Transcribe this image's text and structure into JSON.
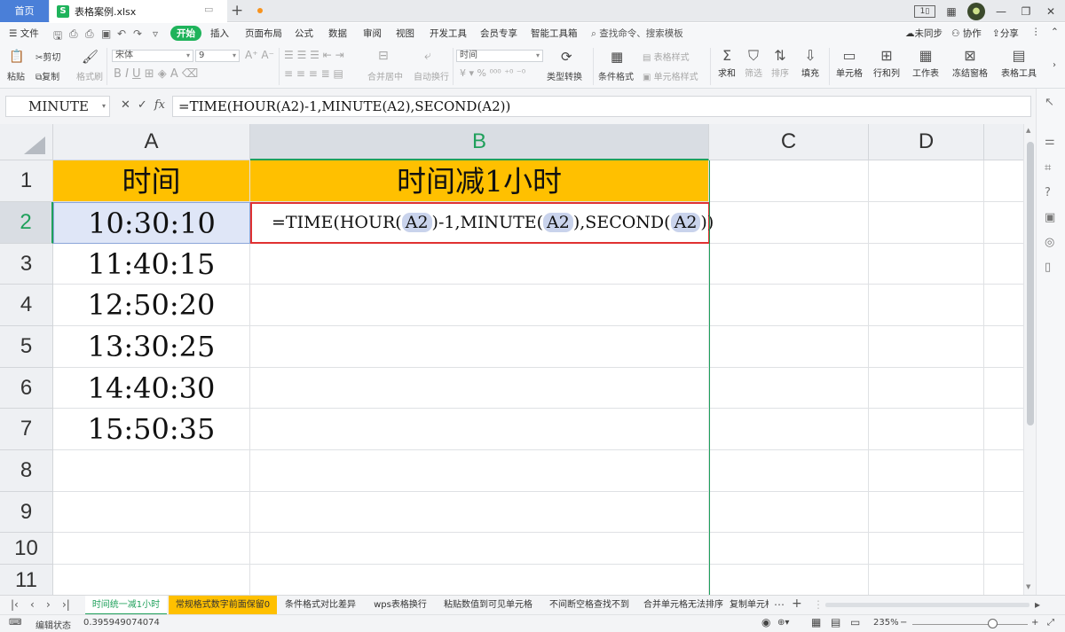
{
  "titlebar": {
    "home_tab": "首页",
    "doc_tab": "表格案例.xlsx",
    "doc_logo": "S",
    "new_tab": "+"
  },
  "menu": {
    "file": "文件",
    "items": [
      "开始",
      "插入",
      "页面布局",
      "公式",
      "数据",
      "审阅",
      "视图",
      "开发工具",
      "会员专享",
      "智能工具箱"
    ],
    "search": "查找命令、搜索模板",
    "sync": "未同步",
    "collab": "协作",
    "share": "分享"
  },
  "ribbon": {
    "cut": "剪切",
    "paste": "粘贴",
    "copy": "复制",
    "format_painter": "格式刷",
    "font_name": "宋体",
    "font_size": "9",
    "merge": "合并居中",
    "wrap": "自动换行",
    "number_format": "时间",
    "type_convert": "类型转换",
    "cond_format": "条件格式",
    "table_style": "表格样式",
    "cell_style": "单元格样式",
    "sum": "求和",
    "filter": "筛选",
    "sort": "排序",
    "fill": "填充",
    "cell": "单元格",
    "row_col": "行和列",
    "worksheet": "工作表",
    "freeze": "冻结窗格",
    "table_tools": "表格工具"
  },
  "formula_bar": {
    "name_box": "MINUTE",
    "fx": "fx",
    "formula": "=TIME(HOUR(A2)-1,MINUTE(A2),SECOND(A2))"
  },
  "grid": {
    "columns": [
      "A",
      "B",
      "C",
      "D"
    ],
    "rows": [
      "1",
      "2",
      "3",
      "4",
      "5",
      "6",
      "7",
      "8",
      "9",
      "10",
      "11"
    ],
    "header_a": "时间",
    "header_b": "时间减1小时",
    "times": [
      "10:30:10",
      "11:40:15",
      "12:50:20",
      "13:30:25",
      "14:40:30",
      "15:50:35"
    ],
    "edit_formula": {
      "p1": "=TIME(HOUR(",
      "r1": "A2",
      "p2": ")-1,MINUTE(",
      "r2": "A2",
      "p3": "),SECOND(",
      "r3": "A2",
      "p4": "))"
    }
  },
  "sheets": [
    "时间统一减1小时",
    "常规格式数字前面保留0",
    "条件格式对比差异",
    "wps表格换行",
    "粘贴数值到可见单元格",
    "不间断空格查找不到",
    "合并单元格无法排序",
    "复制单元格"
  ],
  "status": {
    "mode": "编辑状态",
    "value": "0.395949074074",
    "zoom": "235%"
  },
  "colors": {
    "accent": "#1fa05b",
    "header_fill": "#ffc000",
    "edit_border": "#e03131",
    "home_tab": "#4a7fd8"
  }
}
